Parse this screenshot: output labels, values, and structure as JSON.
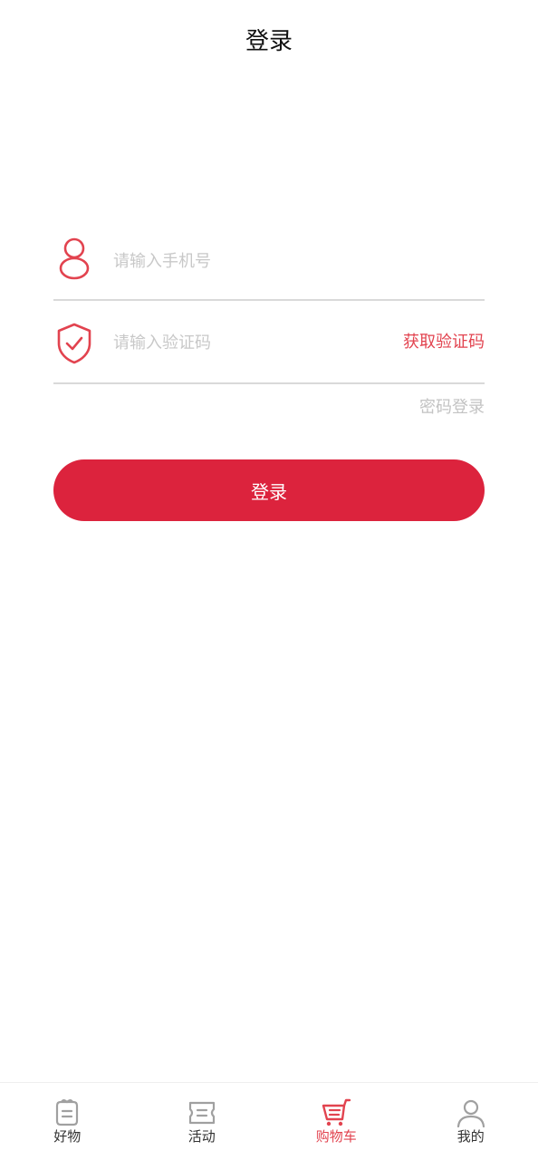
{
  "header": {
    "title": "登录"
  },
  "form": {
    "phone": {
      "placeholder": "请输入手机号",
      "value": "",
      "icon": "user-icon"
    },
    "code": {
      "placeholder": "请输入验证码",
      "value": "",
      "icon": "shield-check-icon",
      "get_code_label": "获取验证码"
    },
    "password_login_label": "密码登录",
    "submit_label": "登录"
  },
  "tabbar": {
    "items": [
      {
        "label": "好物",
        "icon": "gift-icon",
        "active": false
      },
      {
        "label": "活动",
        "icon": "ticket-icon",
        "active": false
      },
      {
        "label": "购物车",
        "icon": "cart-icon",
        "active": true
      },
      {
        "label": "我的",
        "icon": "profile-icon",
        "active": false
      }
    ]
  },
  "colors": {
    "accent": "#dc233d",
    "accent_text": "#e2434f",
    "placeholder": "#c8c8c8",
    "divider": "#d9d9d9",
    "inactive_icon": "#a0a0a0"
  }
}
